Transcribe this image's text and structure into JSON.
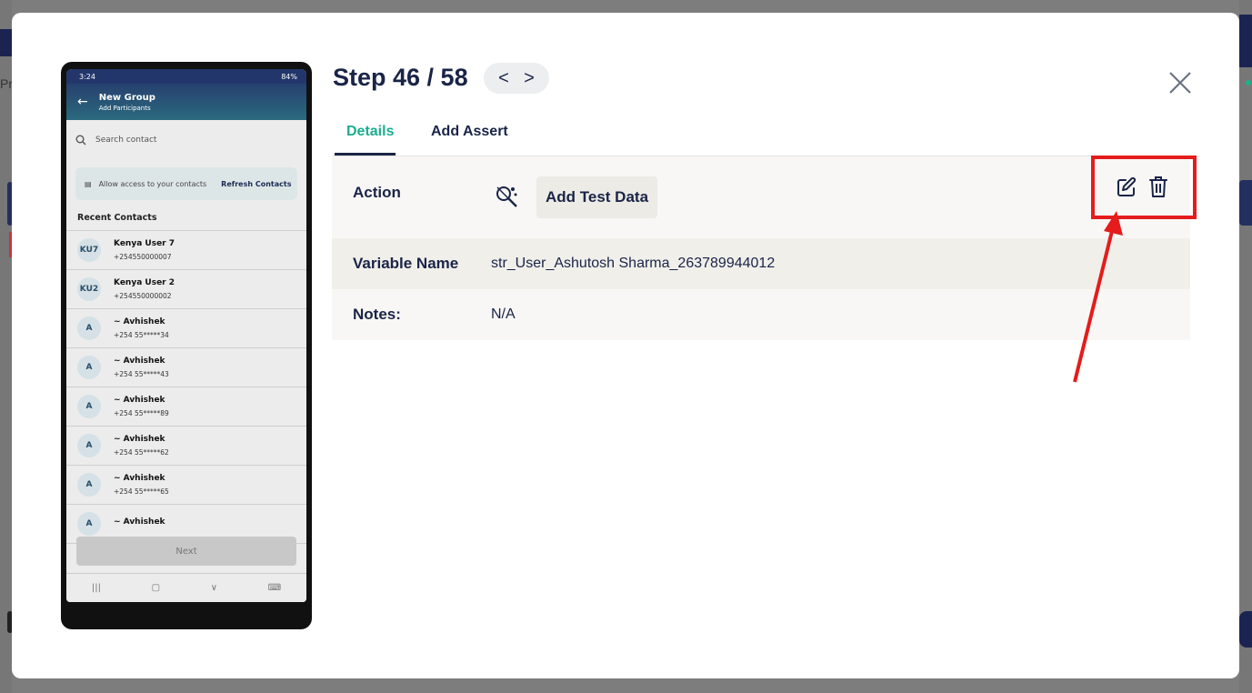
{
  "background": {
    "left_text": "Pro"
  },
  "phone": {
    "status_time": "3:24",
    "status_battery": "84%",
    "app_title": "New Group",
    "app_subtitle": "Add Participants",
    "search_placeholder": "Search contact",
    "allow_text": "Allow access to your contacts",
    "refresh_label": "Refresh Contacts",
    "recent_header": "Recent Contacts",
    "contacts": [
      {
        "initials": "KU7",
        "name": "Kenya User 7",
        "phone": "+254550000007"
      },
      {
        "initials": "KU2",
        "name": "Kenya User 2",
        "phone": "+254550000002"
      },
      {
        "initials": "A",
        "name": "~ Avhishek",
        "phone": "+254 55*****34"
      },
      {
        "initials": "A",
        "name": "~ Avhishek",
        "phone": "+254 55*****43"
      },
      {
        "initials": "A",
        "name": "~ Avhishek",
        "phone": "+254 55*****89"
      },
      {
        "initials": "A",
        "name": "~ Avhishek",
        "phone": "+254 55*****62"
      },
      {
        "initials": "A",
        "name": "~ Avhishek",
        "phone": "+254 55*****65"
      },
      {
        "initials": "A",
        "name": "~ Avhishek",
        "phone": ""
      }
    ],
    "next_label": "Next"
  },
  "header": {
    "step_label": "Step 46 / 58",
    "prev_glyph": "<",
    "next_glyph": ">"
  },
  "tabs": [
    {
      "label": "Details",
      "active": true
    },
    {
      "label": "Add Assert",
      "active": false
    }
  ],
  "details": {
    "action_label": "Action",
    "action_value": "Add Test Data",
    "variable_label": "Variable Name",
    "variable_value": "str_User_Ashutosh Sharma_263789944012",
    "notes_label": "Notes:",
    "notes_value": "N/A"
  },
  "colors": {
    "accent": "#1cae8f",
    "navy": "#1a2447",
    "annotation_red": "#e41c1c"
  }
}
